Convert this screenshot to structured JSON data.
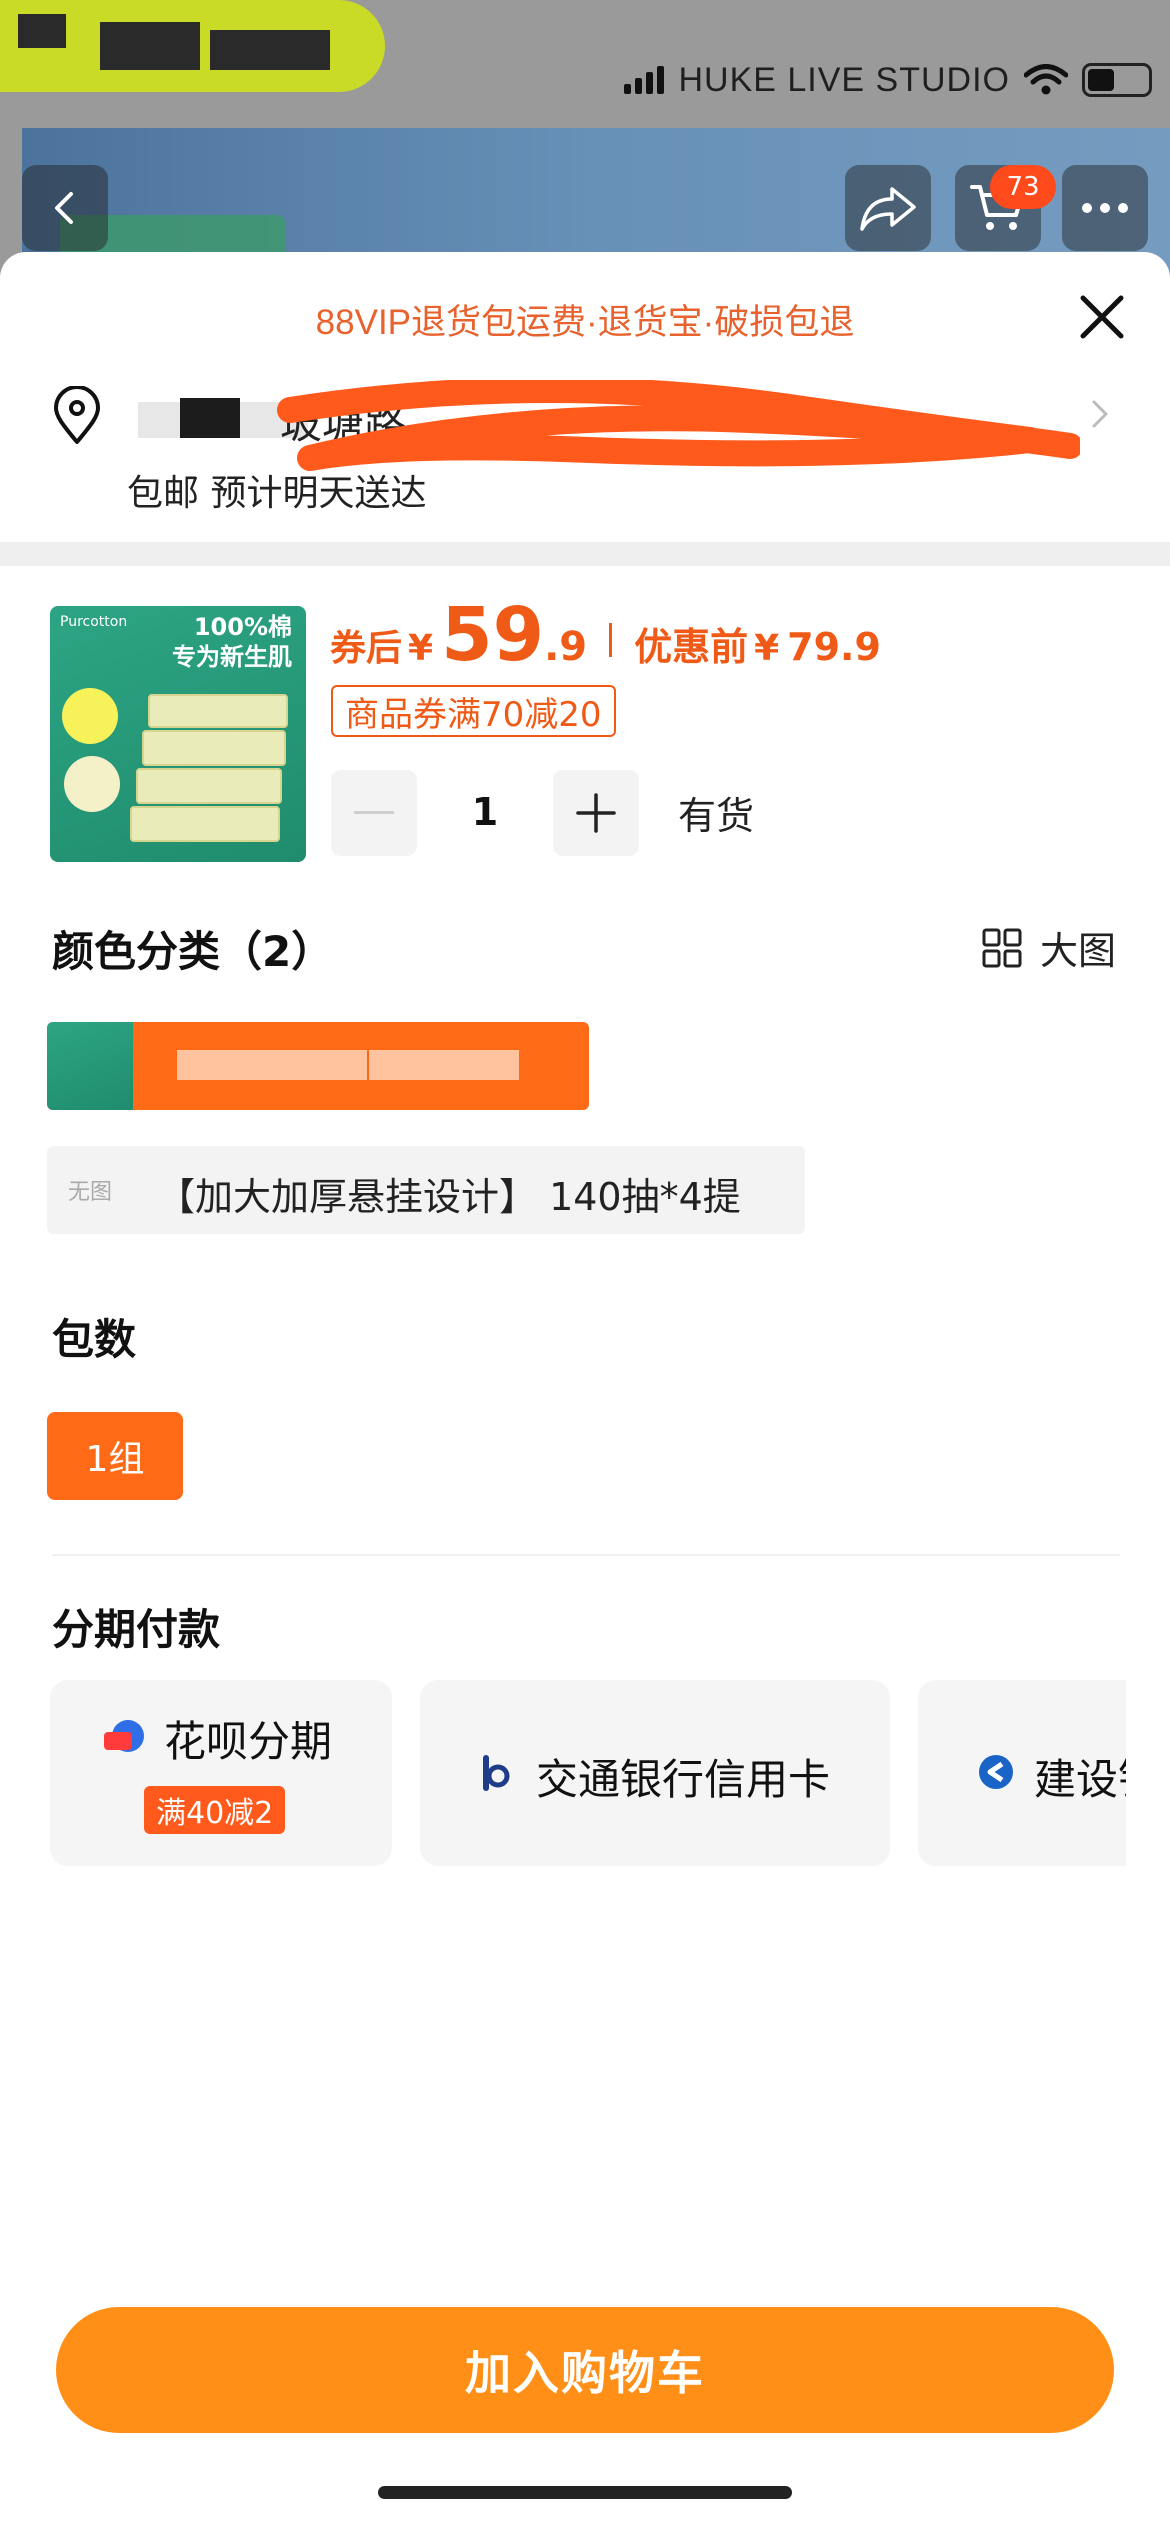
{
  "status_bar": {
    "overlay_text": "HUKE LIVE STUDIO"
  },
  "nav": {
    "cart_count": "73"
  },
  "sheet": {
    "vip_banner": "88VIP退货包运费·退货宝·破损包退",
    "address_visible_fragment": "玻塘路",
    "delivery": "包邮 预计明天送达",
    "product": {
      "thumb_brand": "Purcotton",
      "thumb_tagline_1": "100%棉",
      "thumb_tagline_2": "专为新生肌",
      "price_after_label": "券后",
      "currency": "¥",
      "price_after_int": "59",
      "price_after_dec": ".9",
      "price_before_label": "优惠前",
      "price_before": "79.9",
      "coupon": "商品券满70减20",
      "quantity": "1",
      "stock": "有货"
    },
    "color_section": {
      "title": "颜色分类（2）",
      "bigview_label": "大图",
      "option2_noimg": "无图",
      "option2_text": "【加大加厚悬挂设计】 140抽*4提"
    },
    "package_section": {
      "title": "包数",
      "option": "1组"
    },
    "installment_section": {
      "title": "分期付款",
      "options": [
        {
          "label": "花呗分期",
          "promo": "满40减2"
        },
        {
          "label": "交通银行信用卡"
        },
        {
          "label": "建设银"
        }
      ]
    },
    "add_to_cart": "加入购物车"
  },
  "colors": {
    "accent_orange": "#ff6a17",
    "price_orange": "#f05a17",
    "cta_orange": "#ff8f16"
  }
}
